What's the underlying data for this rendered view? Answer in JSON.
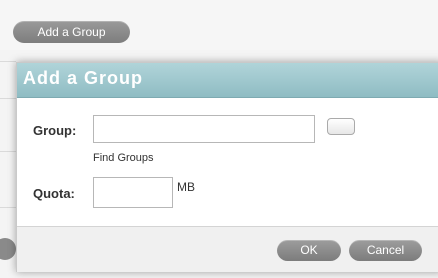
{
  "toolbar": {
    "add_group_label": "Add a Group"
  },
  "dialog": {
    "title": "Add a Group",
    "group_label": "Group:",
    "group_value": "",
    "find_groups_label": "Find Groups",
    "quota_label": "Quota:",
    "quota_value": "",
    "quota_unit": "MB",
    "ok_label": "OK",
    "cancel_label": "Cancel"
  },
  "colors": {
    "title_bar": "#9fc8ce",
    "pill_button": "#8a8a8a"
  }
}
